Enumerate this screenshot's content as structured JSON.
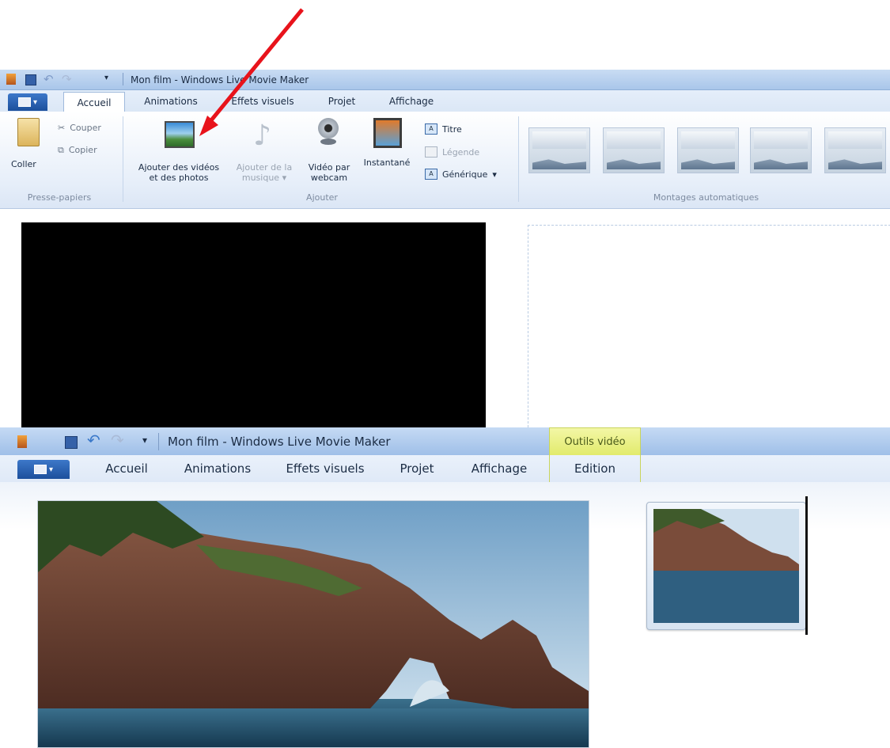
{
  "top": {
    "title": "Mon film - Windows Live Movie Maker",
    "tabs": [
      "Accueil",
      "Animations",
      "Effets visuels",
      "Projet",
      "Affichage"
    ],
    "clipboard": {
      "paste": "Coller",
      "cut": "Couper",
      "copy": "Copier",
      "group": "Presse-papiers"
    },
    "add": {
      "add_videos_line1": "Ajouter des vidéos",
      "add_videos_line2": "et des photos",
      "add_music_line1": "Ajouter de la",
      "add_music_line2": "musique",
      "webcam_line1": "Vidéo par",
      "webcam_line2": "webcam",
      "snapshot": "Instantané",
      "title": "Titre",
      "caption": "Légende",
      "credits": "Générique",
      "group": "Ajouter"
    },
    "automovie": {
      "group": "Montages automatiques"
    }
  },
  "bottom": {
    "title": "Mon film - Windows Live Movie Maker",
    "context_group": "Outils vidéo",
    "tabs": [
      "Accueil",
      "Animations",
      "Effets visuels",
      "Projet",
      "Affichage"
    ],
    "context_tab": "Edition"
  },
  "colors": {
    "arrow": "#e8131b",
    "accent": "#2a5fae"
  }
}
